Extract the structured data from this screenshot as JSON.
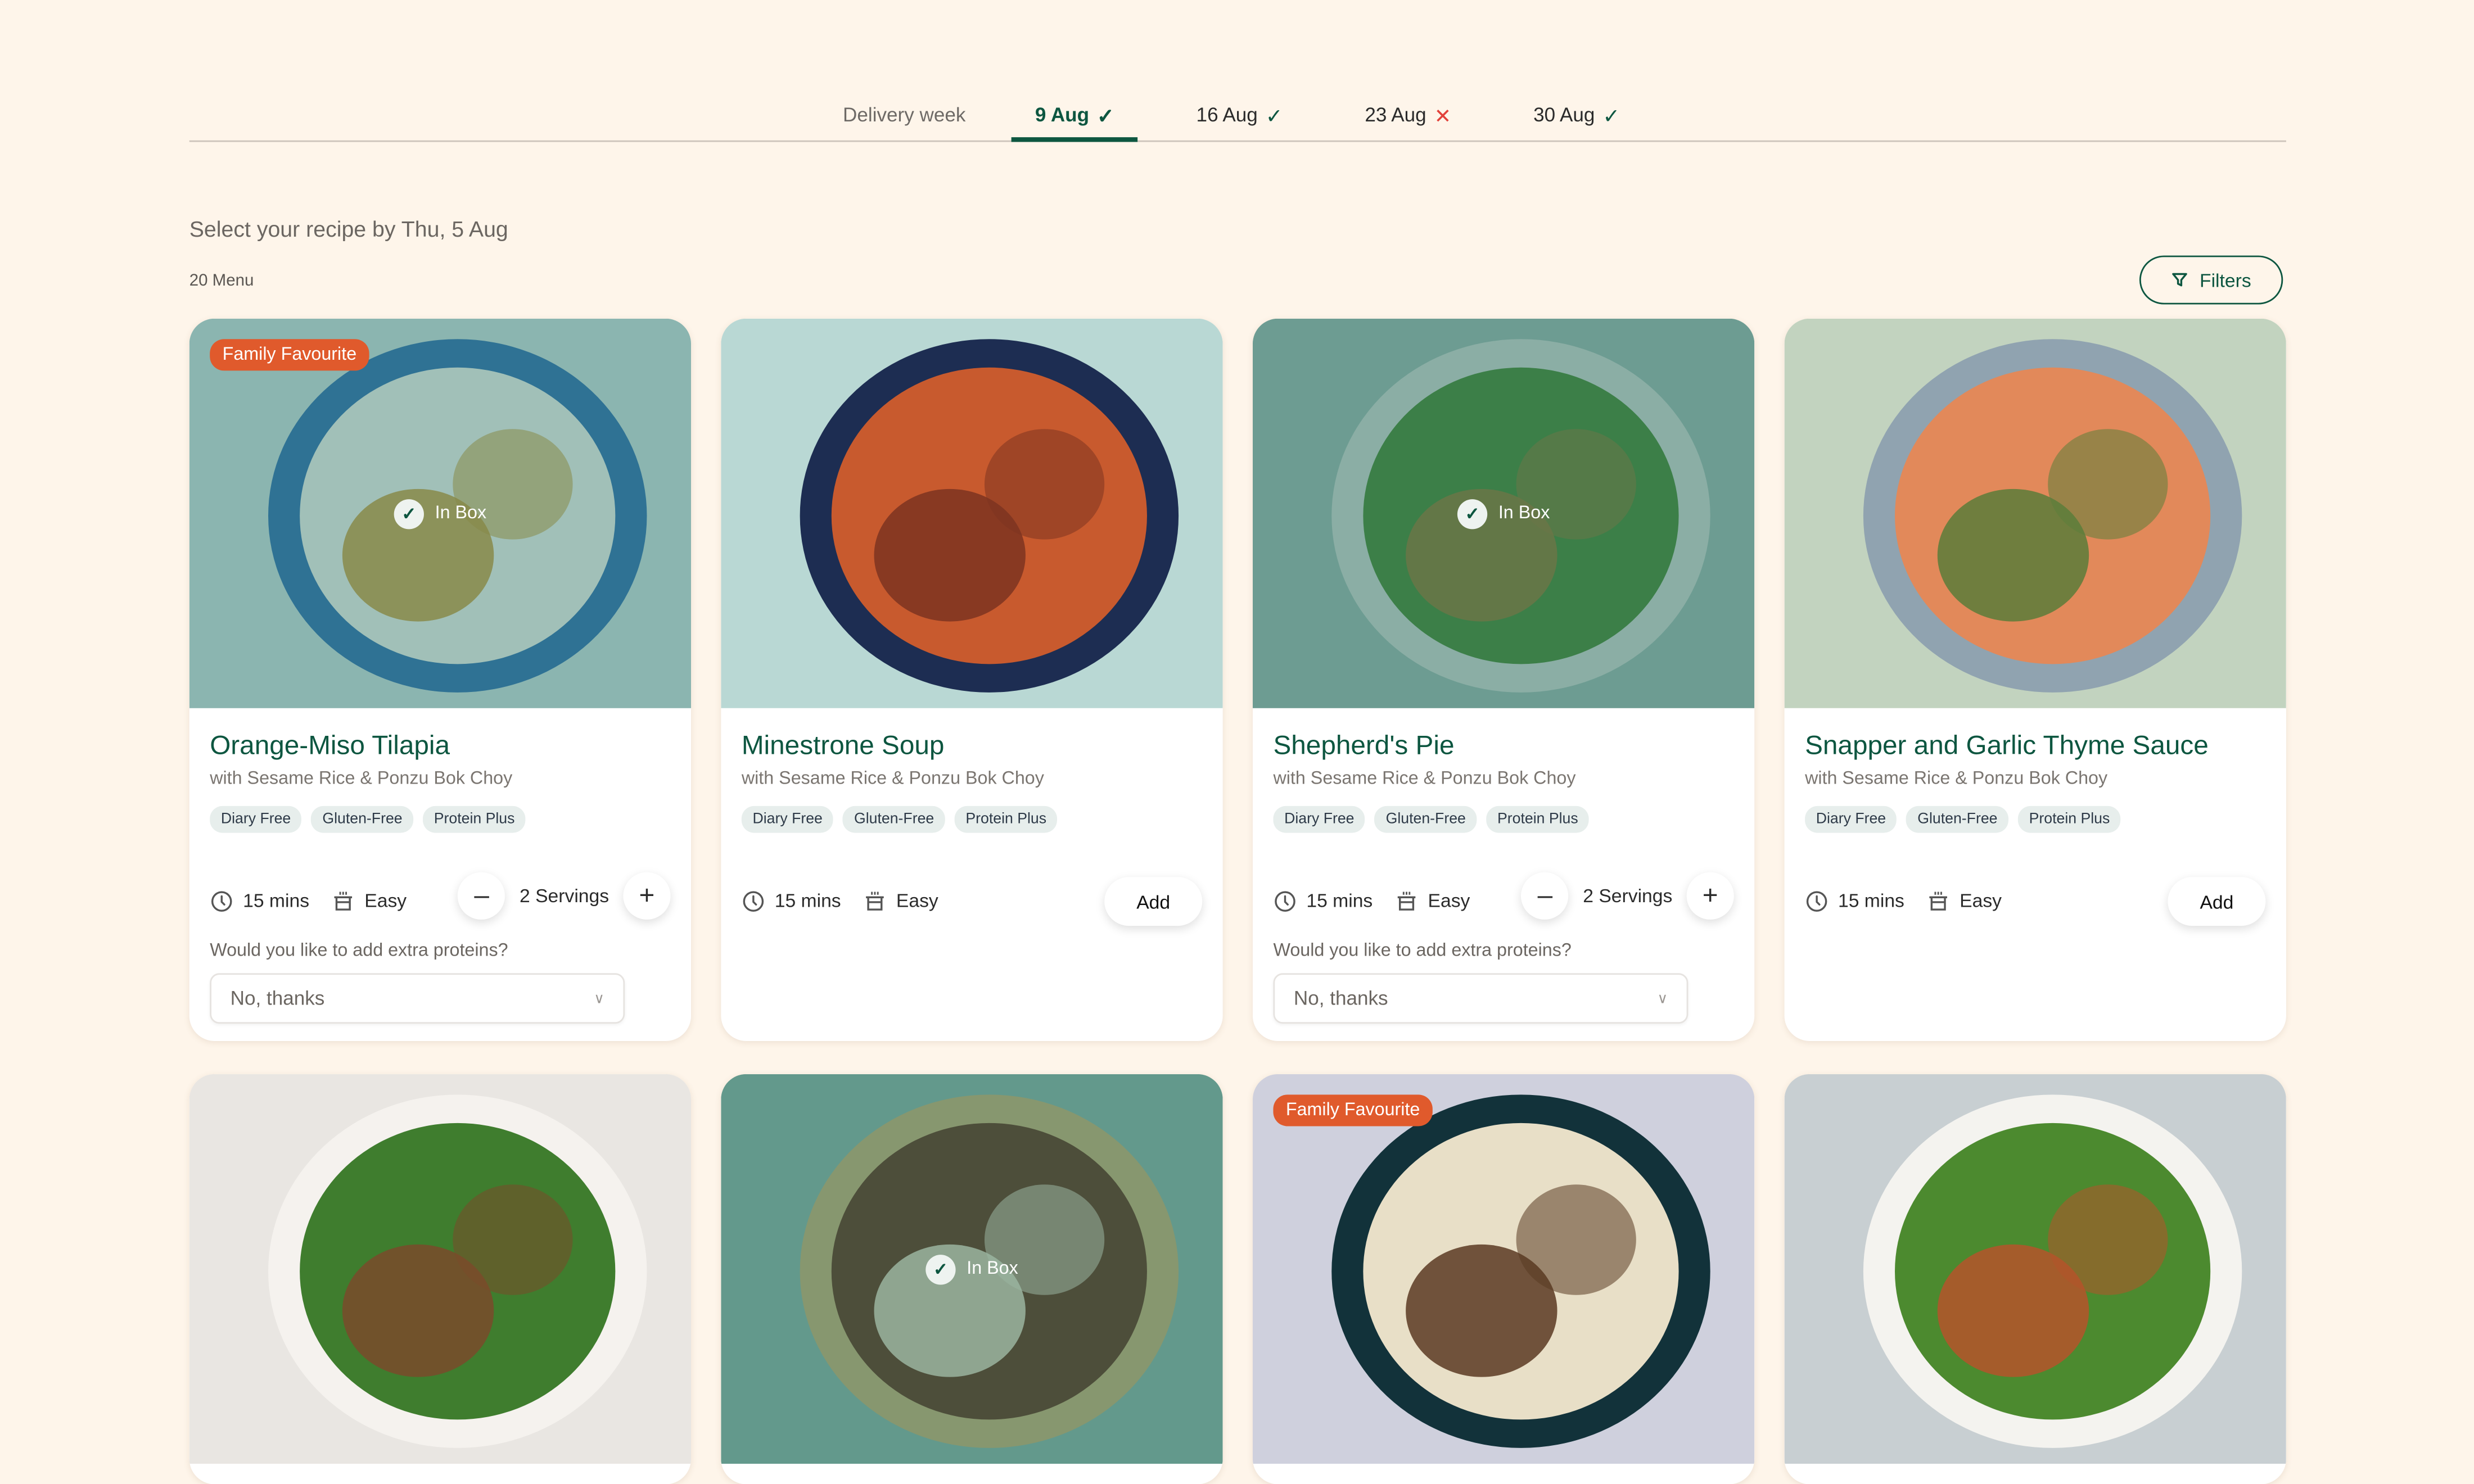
{
  "week_tabs": {
    "label": "Delivery week",
    "tabs": [
      {
        "label": "9 Aug",
        "status": "ok",
        "mark": "✓",
        "active": true
      },
      {
        "label": "16 Aug",
        "status": "ok",
        "mark": "✓",
        "active": false
      },
      {
        "label": "23 Aug",
        "status": "no",
        "mark": "✕",
        "active": false
      },
      {
        "label": "30 Aug",
        "status": "ok",
        "mark": "✓",
        "active": false
      }
    ]
  },
  "deadline": "Select your recipe by Thu, 5 Aug",
  "menu_count": "20 Menu",
  "filters_label": "Filters",
  "colors": {
    "brand": "#0d5640",
    "badge": "#e05a2c",
    "error": "#e2413a",
    "background": "#fef5ea"
  },
  "common": {
    "inbox_label": "In Box",
    "badge_label": "Family Favourite",
    "add_label": "Add",
    "protein_question": "Would you like to add extra proteins?",
    "protein_select_value": "No, thanks"
  },
  "recipes": [
    {
      "title": "Orange-Miso Tilapia",
      "subtitle": "with Sesame Rice & Ponzu Bok Choy",
      "tags": [
        "Diary Free",
        "Gluten-Free",
        "Protein Plus"
      ],
      "time": "15 mins",
      "difficulty": "Easy",
      "in_box": true,
      "badge": true,
      "servings": "2 Servings"
    },
    {
      "title": "Minestrone Soup",
      "subtitle": "with Sesame Rice & Ponzu Bok Choy",
      "tags": [
        "Diary Free",
        "Gluten-Free",
        "Protein Plus"
      ],
      "time": "15 mins",
      "difficulty": "Easy",
      "in_box": false,
      "badge": false
    },
    {
      "title": "Shepherd's Pie",
      "subtitle": "with Sesame Rice & Ponzu Bok Choy",
      "tags": [
        "Diary Free",
        "Gluten-Free",
        "Protein Plus"
      ],
      "time": "15 mins",
      "difficulty": "Easy",
      "in_box": true,
      "badge": false,
      "servings": "2 Servings"
    },
    {
      "title": "Snapper and Garlic Thyme Sauce",
      "subtitle": "with Sesame Rice & Ponzu Bok Choy",
      "tags": [
        "Diary Free",
        "Gluten-Free",
        "Protein Plus"
      ],
      "time": "15 mins",
      "difficulty": "Easy",
      "in_box": false,
      "badge": false
    },
    {
      "in_box": false,
      "badge": false
    },
    {
      "in_box": true,
      "badge": false
    },
    {
      "in_box": false,
      "badge": true
    },
    {
      "in_box": false,
      "badge": false
    }
  ]
}
